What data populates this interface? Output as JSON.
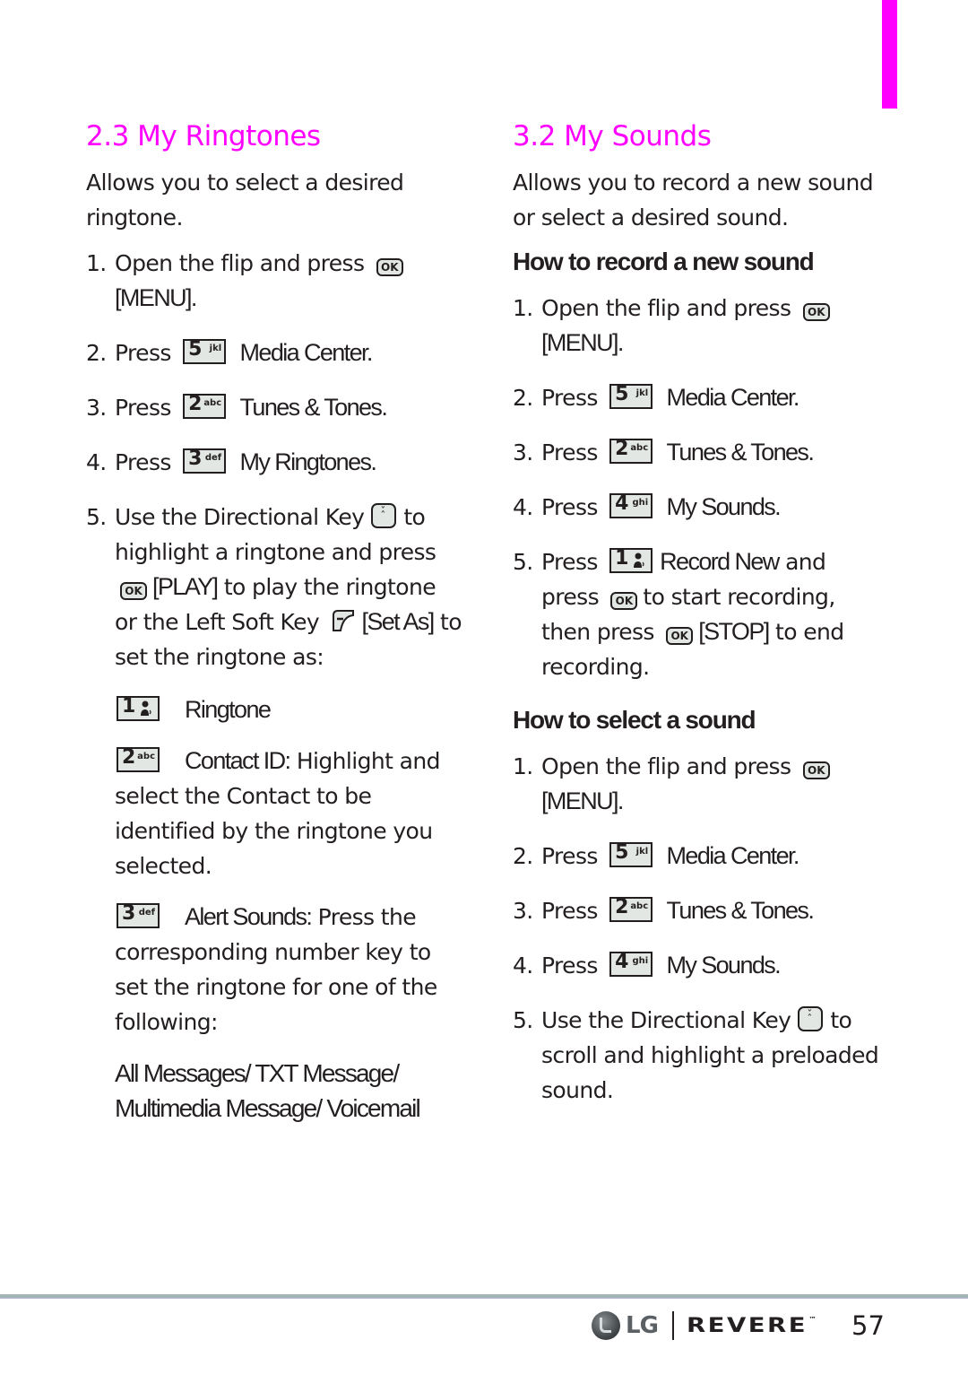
{
  "accent_color": "#ff00ff",
  "left": {
    "title": "2.3 My Ringtones",
    "intro": "Allows you to select a desired ringtone.",
    "steps": [
      {
        "num": "1.",
        "pre": "Open the flip and press",
        "key": "OK",
        "post": "[MENU]."
      },
      {
        "num": "2.",
        "pre": "Press",
        "key_digit": "5",
        "key_letters": "jkl",
        "post": "Media Center."
      },
      {
        "num": "3.",
        "pre": "Press",
        "key_digit": "2",
        "key_letters": "abc",
        "post": "Tunes & Tones."
      },
      {
        "num": "4.",
        "pre": "Press",
        "key_digit": "3",
        "key_letters": "def",
        "post": "My Ringtones."
      },
      {
        "num": "5.",
        "pre": "Use the Directional Key",
        "mid1": "to highlight a ringtone and press",
        "ok": "OK",
        "mid2": "[PLAY]",
        "mid3": "to play the ringtone or the Left Soft Key",
        "mid4": "[Set As]",
        "post": "to set the ringtone as:"
      }
    ],
    "options": [
      {
        "key_digit": "1",
        "label": "Ringtone",
        "desc": ""
      },
      {
        "key_digit": "2",
        "key_letters": "abc",
        "label": "Contact ID:",
        "desc": "Highlight and select the Contact to be identified by the ringtone you selected."
      },
      {
        "key_digit": "3",
        "key_letters": "def",
        "label": "Alert Sounds:",
        "desc": "Press the corresponding number key to set the ringtone for one of the following:"
      }
    ],
    "alert_list": "All Messages/ TXT Message/ Multimedia Message/ Voicemail"
  },
  "right": {
    "title": "3.2 My Sounds",
    "intro": "Allows you to record a new sound or select a desired sound.",
    "record_heading": "How to record a new sound",
    "record_steps": [
      {
        "num": "1.",
        "pre": "Open the flip and press",
        "key": "OK",
        "post": "[MENU]."
      },
      {
        "num": "2.",
        "pre": "Press",
        "key_digit": "5",
        "key_letters": "jkl",
        "post": "Media Center."
      },
      {
        "num": "3.",
        "pre": "Press",
        "key_digit": "2",
        "key_letters": "abc",
        "post": "Tunes & Tones."
      },
      {
        "num": "4.",
        "pre": "Press",
        "key_digit": "4",
        "key_letters": "ghi",
        "post": "My Sounds."
      },
      {
        "num": "5.",
        "pre": "Press",
        "key_digit": "1",
        "label": "Record New",
        "mid1": "and press",
        "ok": "OK",
        "mid2": "to start recording, then press",
        "mid3": "[STOP]",
        "post": "to end recording."
      }
    ],
    "select_heading": "How to select a sound",
    "select_steps": [
      {
        "num": "1.",
        "pre": "Open the flip and press",
        "key": "OK",
        "post": "[MENU]."
      },
      {
        "num": "2.",
        "pre": "Press",
        "key_digit": "5",
        "key_letters": "jkl",
        "post": "Media Center."
      },
      {
        "num": "3.",
        "pre": "Press",
        "key_digit": "2",
        "key_letters": "abc",
        "post": "Tunes & Tones."
      },
      {
        "num": "4.",
        "pre": "Press",
        "key_digit": "4",
        "key_letters": "ghi",
        "post": "My Sounds."
      },
      {
        "num": "5.",
        "pre": "Use the Directional Key",
        "post": "to scroll and highlight a preloaded sound."
      }
    ]
  },
  "footer": {
    "logo_text": "LG",
    "brand": "REVERE",
    "trademark": "™",
    "page_number": "57"
  }
}
